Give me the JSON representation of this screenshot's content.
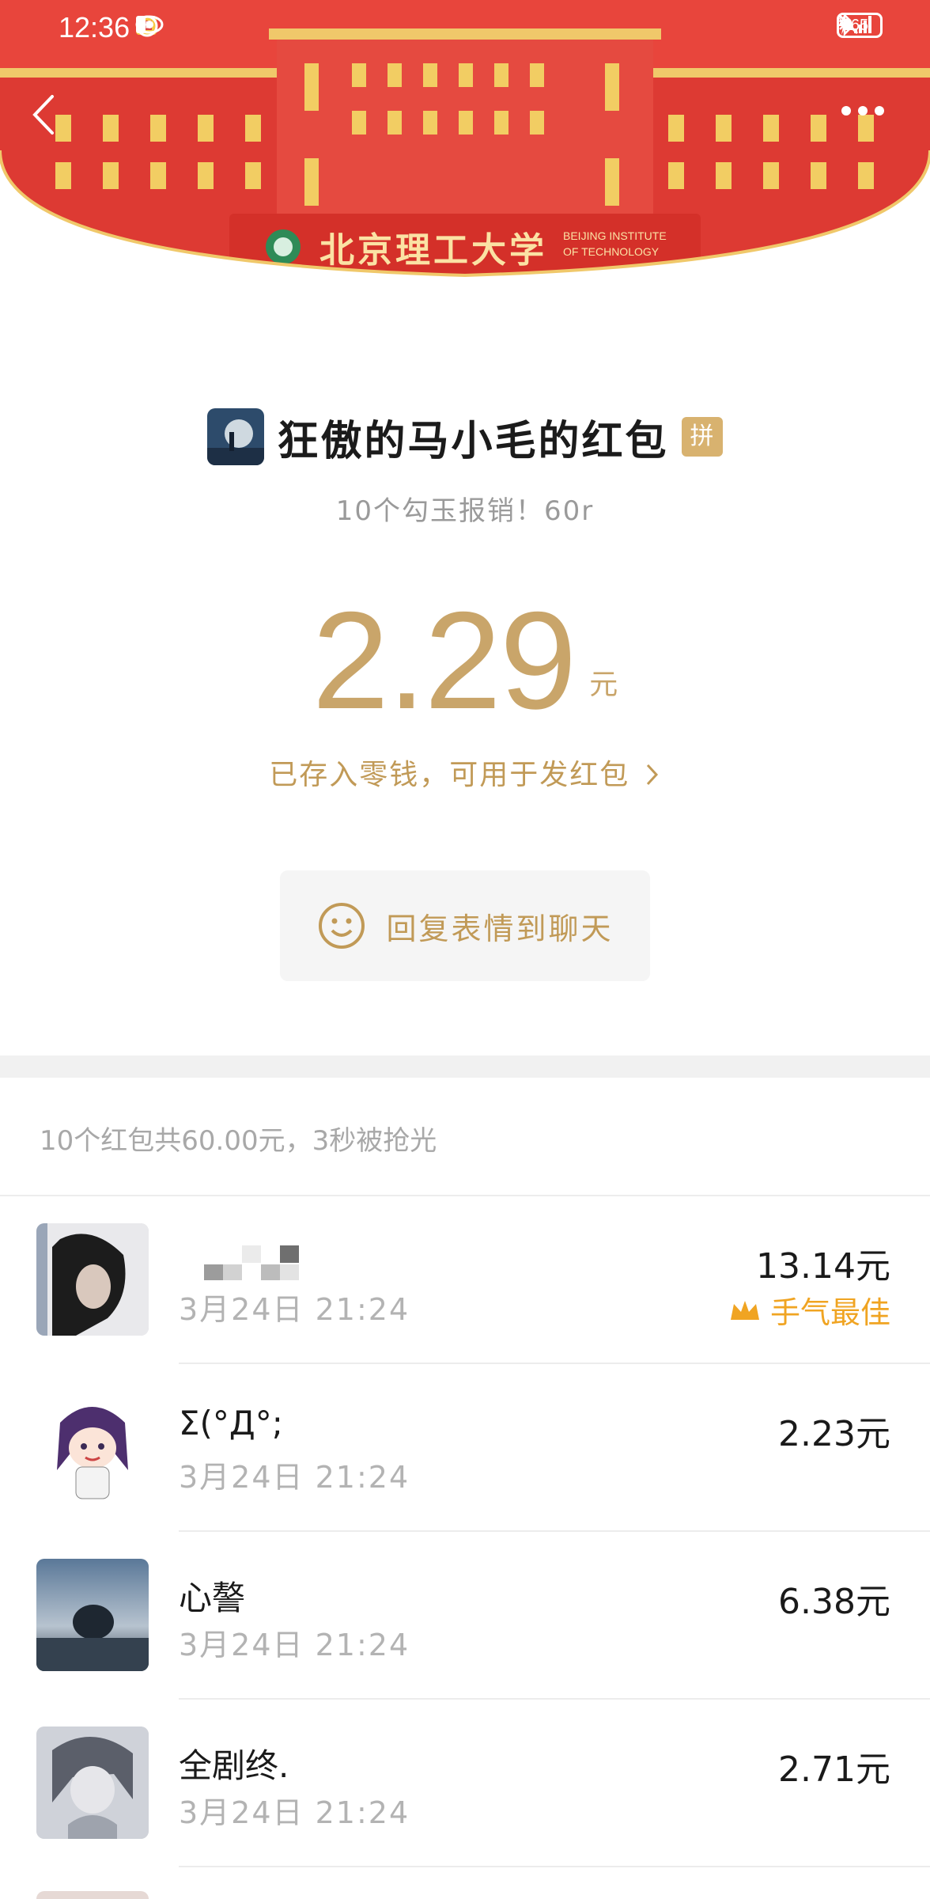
{
  "status_bar": {
    "time": "12:36",
    "battery": "65"
  },
  "header": {
    "banner_school_cn": "北京理工大学",
    "banner_school_en_1": "BEIJING INSTITUTE",
    "banner_school_en_2": "OF TECHNOLOGY"
  },
  "packet": {
    "sender_title": "狂傲的马小毛的红包",
    "pin_badge": "拼",
    "blessing": "10个勾玉报销！60r",
    "amount": "2.29",
    "amount_unit": "元",
    "stored_link": "已存入零钱，可用于发红包",
    "reply_label": "回复表情到聊天"
  },
  "summary": "10个红包共60.00元，3秒被抢光",
  "records": [
    {
      "name": "",
      "time": "3月24日   21:24",
      "money": "13.14元",
      "best": "手气最佳"
    },
    {
      "name": "Σ(°Д°;",
      "time": "3月24日   21:24",
      "money": "2.23元"
    },
    {
      "name": "心謷",
      "time": "3月24日   21:24",
      "money": "6.38元"
    },
    {
      "name": "全剧终.",
      "time": "3月24日   21:24",
      "money": "2.71元"
    }
  ],
  "colors": {
    "banner_red": "#e8453c",
    "gold": "#c9a56a",
    "best_orange": "#f0a422"
  }
}
